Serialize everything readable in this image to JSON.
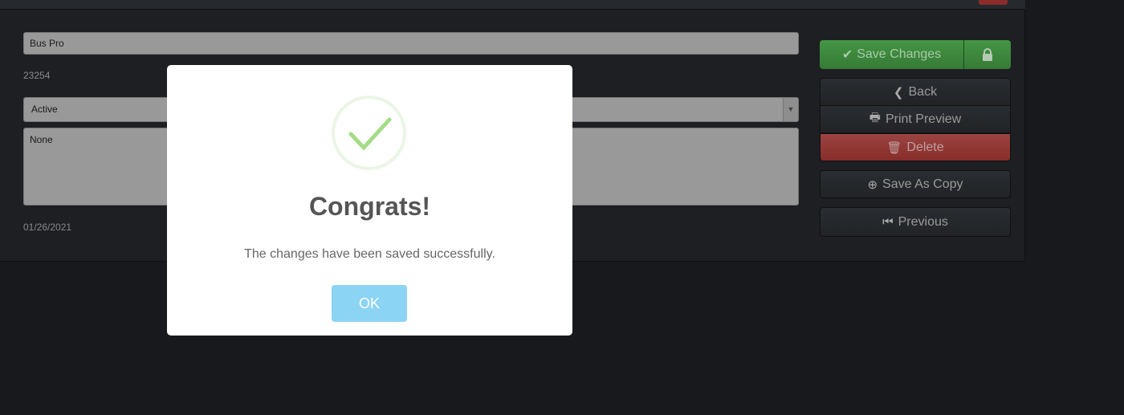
{
  "form": {
    "name_value": "Bus Pro",
    "id_value": "23254",
    "status_value": "Active",
    "notes_value": "None",
    "date_value": "01/26/2021"
  },
  "actions": {
    "save_changes": "Save Changes",
    "back": "Back",
    "print_preview": "Print Preview",
    "delete": "Delete",
    "save_as_copy": "Save As Copy",
    "previous": "Previous"
  },
  "dialog": {
    "title": "Congrats!",
    "message": "The changes have been saved successfully.",
    "ok_label": "OK",
    "icon": "success-check-icon"
  },
  "colors": {
    "success": "#3d8a3d",
    "danger": "#8e2f2d",
    "ok_button": "#8cd4f4",
    "check": "#a5dc86"
  }
}
